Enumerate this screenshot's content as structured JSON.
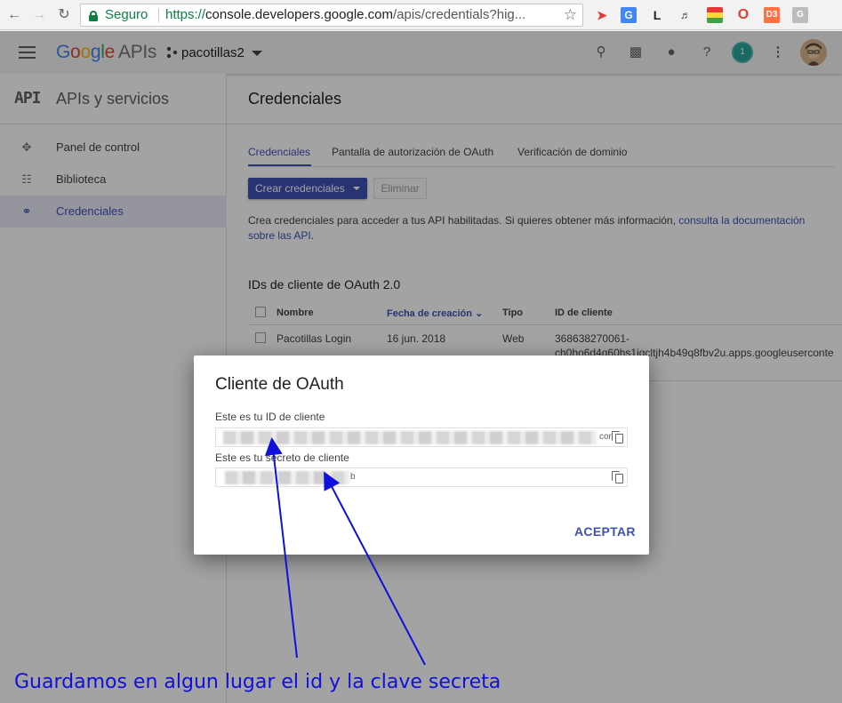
{
  "browser": {
    "secure_label": "Seguro",
    "url_scheme": "https://",
    "url_host": "console.developers.google.com",
    "url_path": "/apis/credentials?hig..."
  },
  "header": {
    "logo_google": "Google",
    "logo_apis": "APIs",
    "project_name": "pacotillas2",
    "notification_count": "1"
  },
  "sidebar": {
    "api_mark": "API",
    "title": "APIs y servicios",
    "items": [
      {
        "label": "Panel de control",
        "icon": "dashboard-icon"
      },
      {
        "label": "Biblioteca",
        "icon": "library-icon"
      },
      {
        "label": "Credenciales",
        "icon": "key-icon",
        "active": true
      }
    ]
  },
  "main": {
    "title": "Credenciales",
    "tabs": [
      {
        "label": "Credenciales",
        "active": true
      },
      {
        "label": "Pantalla de autorización de OAuth"
      },
      {
        "label": "Verificación de dominio"
      }
    ],
    "create_button": "Crear credenciales",
    "delete_button": "Eliminar",
    "info_text": "Crea credenciales para acceder a tus API habilitadas. Si quieres obtener más información, ",
    "info_link": "consulta la documentación sobre las API",
    "info_end": ".",
    "section_title": "IDs de cliente de OAuth 2.0",
    "table": {
      "headers": [
        "Nombre",
        "Fecha de creación",
        "Tipo",
        "ID de cliente"
      ],
      "rows": [
        {
          "name": "Pacotillas Login",
          "date": "16 jun. 2018",
          "type": "Web",
          "client_id_line1": "368638270061-",
          "client_id_line2": "ch0ho6d4q60hs1iqcltjh4b49q8fbv2u.apps.googleuserconte"
        }
      ]
    }
  },
  "dialog": {
    "title": "Cliente de OAuth",
    "client_id_label": "Este es tu ID de cliente",
    "client_id_tail": "cor",
    "secret_label": "Este es tu secreto de cliente",
    "secret_tail": "b",
    "accept_button": "ACEPTAR"
  },
  "annotation": {
    "text": "Guardamos en algun lugar el id y la clave secreta",
    "color": "#1010dd"
  },
  "colors": {
    "accent": "#3f51b5",
    "secure": "#0b8043"
  }
}
